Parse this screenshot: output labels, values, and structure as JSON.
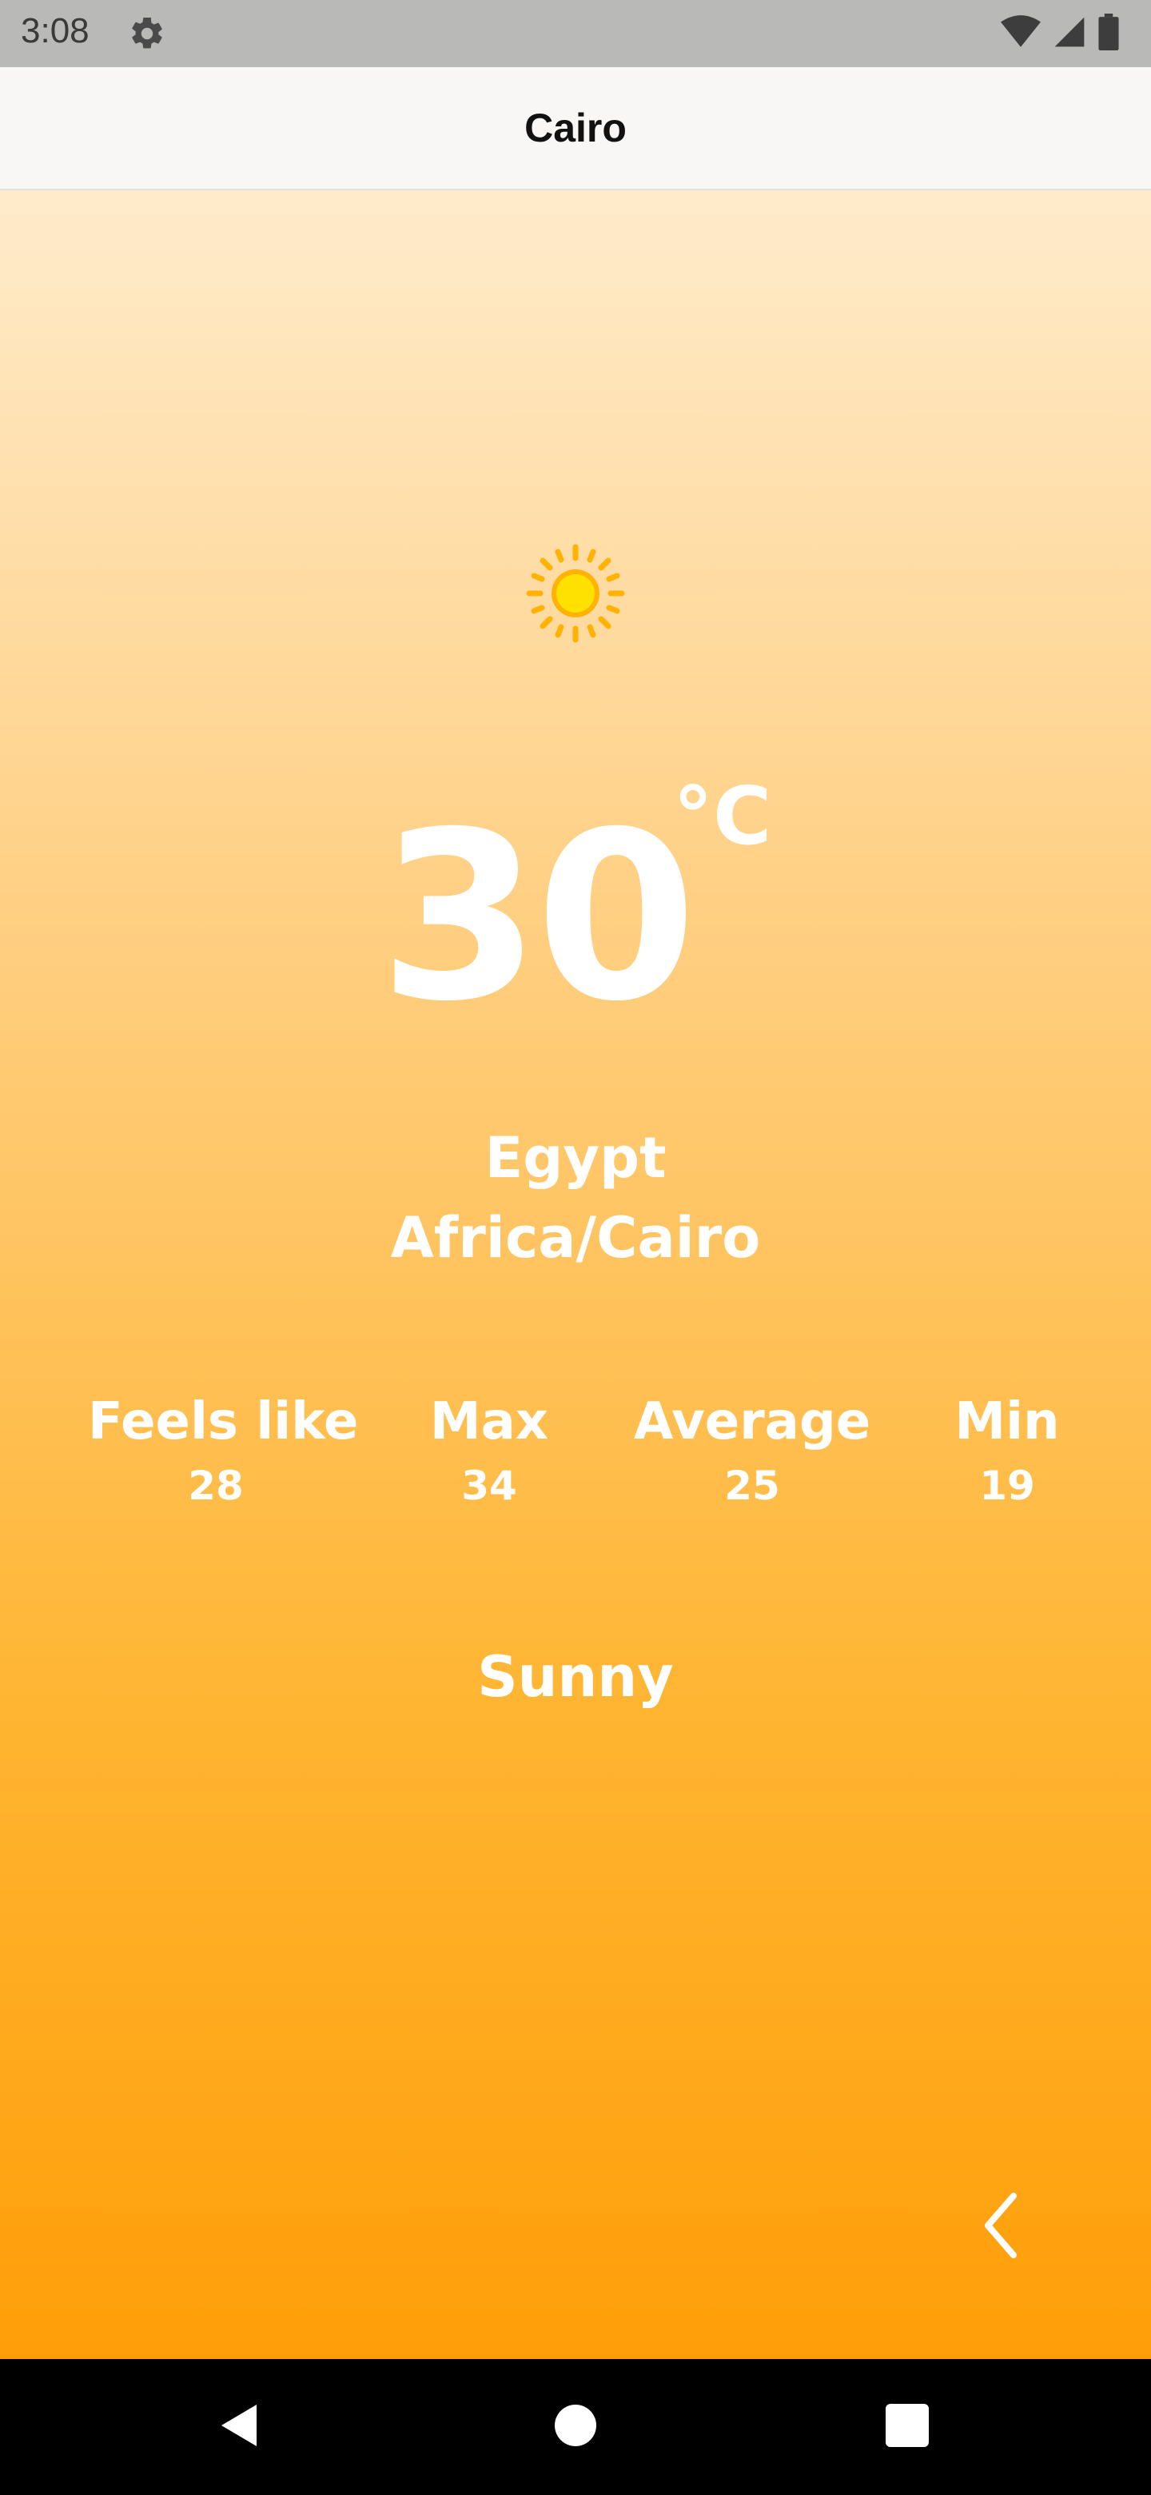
{
  "status_bar": {
    "time": "3:08",
    "icons": [
      "gear-icon",
      "wifi-icon",
      "signal-icon",
      "battery-icon"
    ]
  },
  "app_bar": {
    "title": "Cairo"
  },
  "weather": {
    "icon": "sun-icon",
    "temperature": "30",
    "unit": "°C",
    "country": "Egypt",
    "timezone": "Africa/Cairo",
    "stats": [
      {
        "label": "Feels like",
        "value": "28"
      },
      {
        "label": "Max",
        "value": "34"
      },
      {
        "label": "Average",
        "value": "25"
      },
      {
        "label": "Min",
        "value": "19"
      }
    ],
    "condition": "Sunny"
  },
  "colors": {
    "gradient_top": "#ffebcb",
    "gradient_bottom": "#ff9e08",
    "sun_core": "#ffe100",
    "sun_rays": "#ffb300",
    "text": "#ffffff"
  },
  "navigation": {
    "back_icon": "chevron-left-icon",
    "system_buttons": [
      "back-triangle-icon",
      "home-circle-icon",
      "recents-square-icon"
    ]
  }
}
